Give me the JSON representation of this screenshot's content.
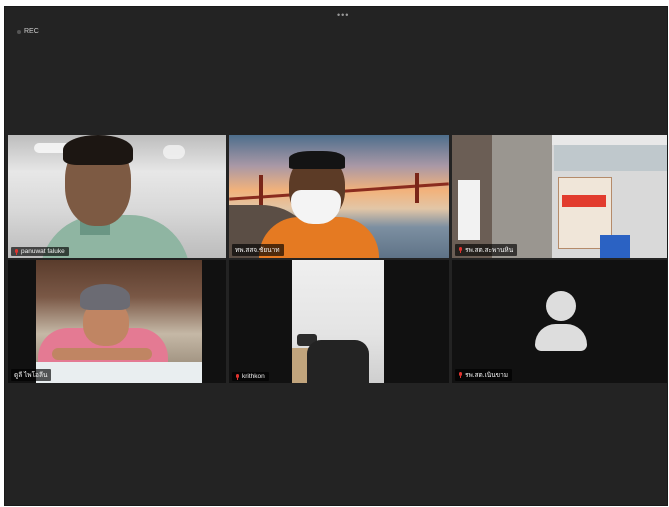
{
  "toolbar": {
    "more_icon": "more-dots-icon",
    "dots": "•••",
    "recording_label": "REC"
  },
  "participants": [
    {
      "name": "panuwat faluke",
      "muted": true,
      "speaking": false
    },
    {
      "name": "ทพ.สสจ.ชัยนาท",
      "muted": false,
      "speaking": true
    },
    {
      "name": "รพ.สต.สะพานหิน",
      "muted": true,
      "speaking": false
    },
    {
      "name": "ดูลี ไพโอลีน",
      "muted": false,
      "speaking": false
    },
    {
      "name": "krithkon",
      "muted": true,
      "speaking": false
    },
    {
      "name": "รพ.สต.เนินขาม",
      "muted": true,
      "speaking": false,
      "avatar": "user-avatar-icon"
    }
  ],
  "colors": {
    "background": "#232323",
    "active_speaker_border": "#5fc46a",
    "muted_mic": "#e0332f"
  }
}
